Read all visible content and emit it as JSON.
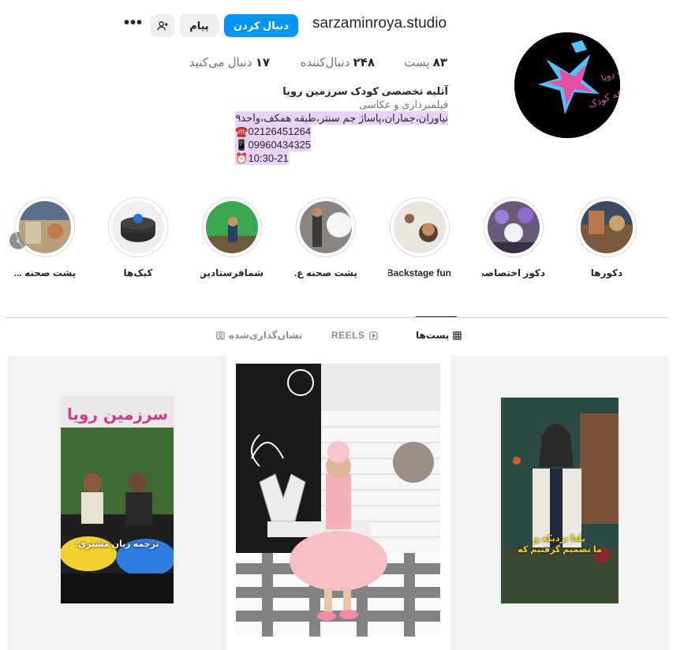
{
  "header": {
    "username": "sarzaminroya.studio",
    "follow_label": "دنبال کردن",
    "message_label": "پیام",
    "more_label": "•••"
  },
  "stats": {
    "posts": "۸۳ پست",
    "followers": "۲۴۸ دنبال‌کننده",
    "following": "۱۷ دنبال می‌کنید"
  },
  "stats_parts": {
    "posts_num": "۸۳",
    "posts_label": "پست",
    "followers_num": "۲۴۸",
    "followers_label": "دنبال‌کننده",
    "following_num": "۱۷",
    "following_label": "دنبال می‌کنید"
  },
  "bio": {
    "name": "آتلیه تخصصی کودک سرزمین رویا",
    "category": "فیلمبرداری و عکاسی",
    "lines": [
      "نیاوران،جماران،پاساژ جم سنتر،طبقه همکف،واحد۹",
      "☎️02126451264",
      "📱09960434325",
      "⏰10:30-21"
    ]
  },
  "highlights": [
    {
      "label": "دکورها"
    },
    {
      "label": "دکور اختصاصی"
    },
    {
      "label": "Backstage fun"
    },
    {
      "label": "پشت صحنه ع..."
    },
    {
      "label": "شمافرستادین!"
    },
    {
      "label": "کیک‌ها"
    },
    {
      "label": "پشت صحنه ..."
    }
  ],
  "tabs": {
    "posts": "پست‌ها",
    "reels": "REELS",
    "tagged": "نشان‌گذاری‌شده"
  },
  "posts": [
    {
      "caption": "ترجمه زبان مشتری:"
    },
    {
      "caption": ""
    },
    {
      "caption_lines": [
        "یلدا نزدیکه و",
        "ما تصمیم گرفتیم که"
      ]
    }
  ],
  "colors": {
    "primary": "#0095f6",
    "bio_highlight": "#e9d2f7",
    "secondary_text": "#737373"
  },
  "icons": [
    "suggest-user-icon",
    "more-icon",
    "grid-icon",
    "reels-icon",
    "tagged-icon",
    "chevron-left-icon"
  ]
}
